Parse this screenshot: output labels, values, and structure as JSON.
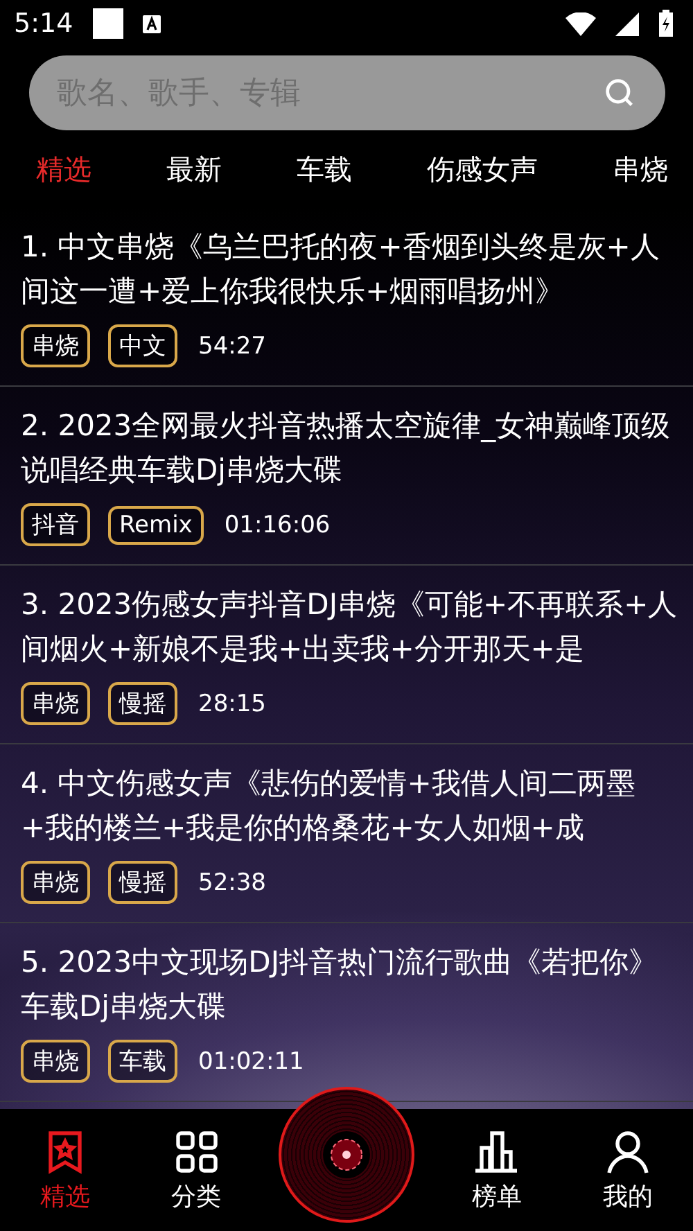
{
  "status_bar": {
    "time": "5:14"
  },
  "search": {
    "placeholder": "歌名、歌手、专辑"
  },
  "tabs": [
    {
      "label": "精选",
      "selected": true
    },
    {
      "label": "最新",
      "selected": false
    },
    {
      "label": "车载",
      "selected": false
    },
    {
      "label": "伤感女声",
      "selected": false
    },
    {
      "label": "串烧",
      "selected": false
    }
  ],
  "songs": [
    {
      "title": "1. 中文串烧《乌兰巴托的夜+香烟到头终是灰+人间这一遭+爱上你我很快乐+烟雨唱扬州》",
      "tags": [
        "串烧",
        "中文"
      ],
      "duration": "54:27"
    },
    {
      "title": "2. 2023全网最火抖音热播太空旋律_女神巅峰顶级说唱经典车载Dj串烧大碟",
      "tags": [
        "抖音",
        "Remix"
      ],
      "duration": "01:16:06"
    },
    {
      "title": "3. 2023伤感女声抖音DJ串烧《可能+不再联系+人间烟火+新娘不是我+出卖我+分开那天+是",
      "tags": [
        "串烧",
        "慢摇"
      ],
      "duration": "28:15"
    },
    {
      "title": "4. 中文伤感女声《悲伤的爱情+我借人间二两墨+我的楼兰+我是你的格桑花+女人如烟+成",
      "tags": [
        "串烧",
        "慢摇"
      ],
      "duration": "52:38"
    },
    {
      "title": "5. 2023中文现场DJ抖音热门流行歌曲《若把你》车载Dj串烧大碟",
      "tags": [
        "串烧",
        "车载"
      ],
      "duration": "01:02:11"
    }
  ],
  "bottom_nav": [
    {
      "kind": "featured",
      "label": "精选",
      "selected": true
    },
    {
      "kind": "categories",
      "label": "分类",
      "selected": false
    },
    {
      "kind": "player",
      "selected": false
    },
    {
      "kind": "charts",
      "label": "榜单",
      "selected": false
    },
    {
      "kind": "profile",
      "label": "我的",
      "selected": false
    }
  ]
}
